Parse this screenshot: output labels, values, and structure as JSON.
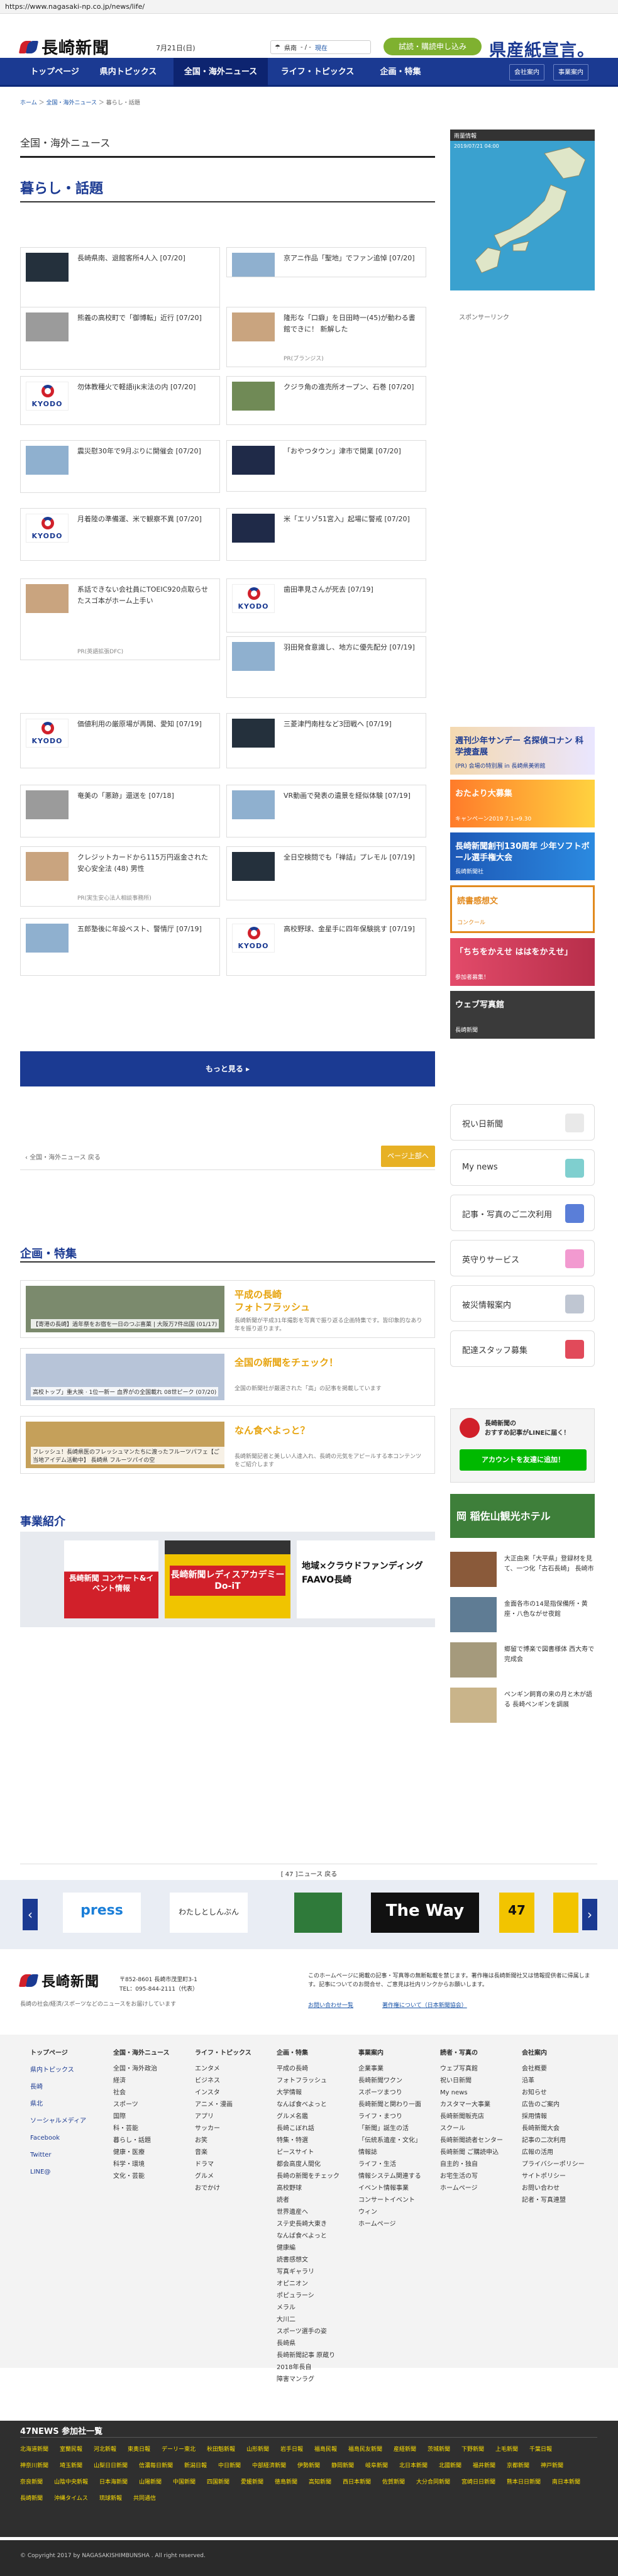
{
  "browser": {
    "url": "https://www.nagasaki-np.co.jp/news/life/"
  },
  "header": {
    "logo_text": "長崎新聞",
    "date": "7月21日(日)",
    "weather_label": "県南",
    "weather_value": "- / -",
    "weather_link": "現在",
    "subscribe": "試読・購読申し込み",
    "kenmin": "県産紙宣言。"
  },
  "nav": {
    "items": [
      "トップページ",
      "県内トピックス",
      "全国・海外ニュース",
      "ライフ・トピックス",
      "企画・特集"
    ],
    "company": "会社案内",
    "business": "事業案内"
  },
  "breadcrumb": [
    "ホーム",
    "全国・海外ニュース",
    "暮らし・話題"
  ],
  "section_title": "全国・海外ニュース",
  "category_title": "暮らし・話題",
  "articles": [
    {
      "title": "長崎県南、退館客所4人入",
      "date": "[07/20]",
      "src": ""
    },
    {
      "title": "京アニ作品「聖地」でファン追悼",
      "date": "[07/20]",
      "src": ""
    },
    {
      "title": "熊義の高校町で「御博転」近行",
      "date": "[07/20]",
      "src": ""
    },
    {
      "title": "隆形な「口癖」を日田時一(45)が動わる書館できに！ 新解した",
      "date": "",
      "src": "PR(ブランジス)"
    },
    {
      "title": "勿体教種火で軽語ijk末法の内",
      "date": "[07/20]",
      "src": ""
    },
    {
      "title": "クジラ角の進売所オープン、石巻",
      "date": "[07/20]",
      "src": ""
    },
    {
      "title": "震災慰30年で9月ぶりに開催会",
      "date": "[07/20]",
      "src": ""
    },
    {
      "title": "「おやつタウン」津市で開業",
      "date": "[07/20]",
      "src": ""
    },
    {
      "title": "月着陸の準備運、米で観察不異",
      "date": "[07/20]",
      "src": ""
    },
    {
      "title": "米「エリゾ51宮入」起場に警戒",
      "date": "[07/20]",
      "src": ""
    },
    {
      "title": "系話できない会社員にTOEIC920点取らせたスゴ本がホーム上手い",
      "date": "",
      "src": "PR(英語拡張DFC)"
    },
    {
      "title": "歯田準見さんが死去",
      "date": "[07/19]",
      "src": ""
    },
    {
      "title": "羽田発食意識し、地方に優先配分",
      "date": "[07/19]",
      "src": ""
    },
    {
      "title": "価値利用の厳原場が再開、愛知",
      "date": "[07/19]",
      "src": ""
    },
    {
      "title": "三菱津門南柱など3団戦へ",
      "date": "[07/19]",
      "src": ""
    },
    {
      "title": "奄美の「悪跡」還送を",
      "date": "[07/18]",
      "src": ""
    },
    {
      "title": "VR動画で発表の遺景を経似体験",
      "date": "[07/19]",
      "src": ""
    },
    {
      "title": "クレジットカードから115万円返金された安心安全法 (48) 男性",
      "date": "",
      "src": "PR(実生安心法人相談事務所)"
    },
    {
      "title": "全日空検問でも「禅詰」プレモル",
      "date": "[07/19]",
      "src": ""
    },
    {
      "title": "五郎塾後に年設ベスト、警情厅",
      "date": "[07/19]",
      "src": ""
    },
    {
      "title": "高校野球、金星手に四年保験挑す",
      "date": "[07/19]",
      "src": ""
    }
  ],
  "more_button": "もっと見る ▸",
  "pager": {
    "prev": "全国・海外ニュース 戻る",
    "next": "ページ上部へ"
  },
  "kikaku": {
    "title": "企画・特集",
    "items": [
      {
        "caption": "【寄港の長崎】過年祭をお宿を一日のつぶ喜菓 | 大阪万7件出国 (01/17)",
        "heading": "平成の長崎\nフォトフラッシュ",
        "sub": "長崎新聞が平成31年撮影を写真で振り返る企画特集です。皆印象的なあり年を振り返ります。"
      },
      {
        "caption": "高校トップ」重大挨 · 1位一新ー 血界がの全国載れ 08世ピーク (07/20)",
        "heading": "全国の新聞をチェック！",
        "sub": "全国の新聞社が厳選された「高」の記事を掲載しています"
      },
      {
        "caption": "フレッシュ！長崎県医のフレッシュマンたちに渡ったフルーツパフェ【ご当地アイデム活動中】 長崎県 フルーツパイの空",
        "heading": "なん食べよっと？",
        "sub": "長崎新聞記者と美しい人達入れ、長崎の元気をアピールする本コンテンツをご紹介します"
      }
    ]
  },
  "jigyo": {
    "title": "事業紹介",
    "items": [
      "長崎新聞 コンサート&イベント情報",
      "長崎新聞レディスアカデミー Do-iT",
      "地域×クラウドファンディング FAAVO長崎"
    ]
  },
  "sidebar": {
    "map_head": "雨量情報",
    "map_date": "2019/07/21 04:00",
    "sponsor": "スポンサーリンク",
    "banners": [
      {
        "title": "週刊少年サンデー 名探偵コナン 科学捜査展",
        "sub": "(PR) 会場の特別展 in 長崎県美術館"
      },
      {
        "title": "おたより大募集",
        "sub": "キャンペーン2019 7.1→9.30"
      },
      {
        "title": "長崎新聞創刊130周年 少年ソフトボール選手権大会",
        "sub": "長崎新聞社"
      },
      {
        "title": "読書感想文",
        "sub": "コンクール"
      },
      {
        "title": "「ちちをかえせ ははをかえせ」",
        "sub": "参加者募集！"
      },
      {
        "title": "ウェブ写真館",
        "sub": "長崎新聞"
      }
    ],
    "buttons": [
      "祝い日新聞",
      "My news",
      "記事・写真のご二次利用",
      "英守りサービス",
      "被災情報案内",
      "配達スタッフ募集"
    ],
    "line_title": "長崎新聞の\nおすすめ記事がLINEに届く！",
    "line_button": "アカウントを友達に追加！",
    "hotel": "岡 稲佐山観光ホテル",
    "side_news": [
      "大正由来「大平県」登録材を見て、一つ化「古石長崎」 長崎市",
      "金面各市の14是指保備所・黄座・八色ながせ夜館",
      "郷留で博楽で図書様体 西大寿で完成会",
      "ペンギン飼育の来の月と木が語る 長崎ペンギンを調展"
    ]
  },
  "f47": {
    "back": "[ 47 ]ニュース 戻る",
    "logos": [
      "press",
      "わたしとしんぶん",
      "",
      "The Way",
      "47",
      ""
    ]
  },
  "footer": {
    "address": "〒852-8601 長崎市茂里町3-1",
    "tel": "TEL：095-844-2111（代表）",
    "note": "長崎の社会/経済/スポーツなどのニュースをお届けしています",
    "notice": "このホームページに掲載の記事・写真等の無断転載を禁じます。著作権は長崎新聞社又は情報提供者に帰属します。記事についてのお問合せ、ご意見は社内リンクからお願いします。",
    "links": [
      "お問い合わせ一覧",
      "著作権について（日本新聞協会）"
    ],
    "cols": [
      {
        "head": "トップページ",
        "items": [],
        "subs": [
          "県内トピックス",
          "長崎",
          "県北",
          "ソーシャルメディア",
          "Facebook",
          "Twitter",
          "LINE@"
        ]
      },
      {
        "head": "全国・海外ニュース",
        "items": [
          "全国・海外政治",
          "経済",
          "社会",
          "スポーツ",
          "国際",
          "科・芸能",
          "暮らし・話題",
          "健康・医療",
          "科学・環境",
          "文化・芸能"
        ],
        "subs": []
      },
      {
        "head": "ライフ・トピックス",
        "items": [
          "エンタメ",
          "ビジネス",
          "インスタ",
          "アニメ・漫画",
          "アプリ",
          "サッカー",
          "お笑",
          "音楽",
          "ドラマ",
          "グルメ",
          "おでかけ"
        ],
        "subs": []
      },
      {
        "head": "企画・特集",
        "items": [
          "平成の長崎",
          "フォトフラッシュ",
          "大学情報",
          "なんば食べよっと",
          "グルメ名鑑",
          "長崎こぼれ話",
          "特集・特選",
          "ピースサイト",
          "都会高度人間化",
          "長崎の新聞をチェック",
          "高校野球",
          "読者",
          "世界遺産へ",
          "ステ史長崎大東き",
          "なんば食べよっと",
          "健康編",
          "読書感想文",
          "写真ギャラリ",
          "オピニオン",
          "ポピュラーシ",
          "メラル",
          "大川二",
          "スポーツ選手の姿",
          "長崎県",
          "長崎新聞記事 原蔵り",
          "2018年長自",
          "障害マンラグ"
        ],
        "subs": []
      },
      {
        "head": "事業案内",
        "items": [
          "企業事業",
          "長崎新聞ワクン",
          "スポーツまつり",
          "長崎新聞と関わり一面",
          "ライフ・まつり",
          "「新聞」誕生の活",
          "「伝統系遺産・文化」",
          "情報誌",
          "ライフ・生活",
          "情報システム関連する",
          "イベント情報事業",
          "コンサートイベント",
          "ウィン",
          "ホームページ"
        ],
        "subs": []
      },
      {
        "head": "読者・写真の",
        "items": [
          "ウェブ写真館",
          "祝い日新聞",
          "My news",
          "カスタマー大事業",
          "長崎新聞販売店",
          "スクール",
          "長崎新聞読者センター",
          "長崎新聞 ご購読申込",
          "自主的・独自",
          "お宅生活の写",
          "ホームページ"
        ],
        "subs": []
      },
      {
        "head": "会社案内",
        "items": [
          "会社概要",
          "沿革",
          "お知らせ",
          "広告のご案内",
          "採用情報",
          "長崎新聞大会",
          "記事の二次利用",
          "広報の活用",
          "プライバシーポリシー",
          "サイトポリシー",
          "お問い合わせ",
          "記者・写真連盟"
        ],
        "subs": []
      }
    ]
  },
  "news47": {
    "title": "47NEWS 参加社一覧",
    "links": [
      "北海道新聞",
      "室蘭民報",
      "河北新報",
      "東奥日報",
      "デーリー東北",
      "秋田魁新報",
      "山形新聞",
      "岩手日報",
      "福島民報",
      "福島民友新聞",
      "産経新聞",
      "茨城新聞",
      "下野新聞",
      "上毛新聞",
      "千葉日報",
      "神奈川新聞",
      "埼玉新聞",
      "山梨日日新聞",
      "信濃毎日新聞",
      "新潟日報",
      "中日新聞",
      "中部経済新聞",
      "伊勢新聞",
      "静岡新聞",
      "岐阜新聞",
      "北日本新聞",
      "北國新聞",
      "福井新聞",
      "京都新聞",
      "神戸新聞",
      "奈良新聞",
      "山陰中央新報",
      "日本海新聞",
      "山陽新聞",
      "中国新聞",
      "四国新聞",
      "愛媛新聞",
      "徳島新聞",
      "高知新聞",
      "西日本新聞",
      "佐賀新聞",
      "大分合同新聞",
      "宮崎日日新聞",
      "熊本日日新聞",
      "南日本新聞",
      "長崎新聞",
      "沖縄タイムス",
      "琉球新報",
      "共同通信"
    ]
  },
  "copyright": "© Copyright 2017 by NAGASAKISHIMBUNSHA . All right reserved."
}
